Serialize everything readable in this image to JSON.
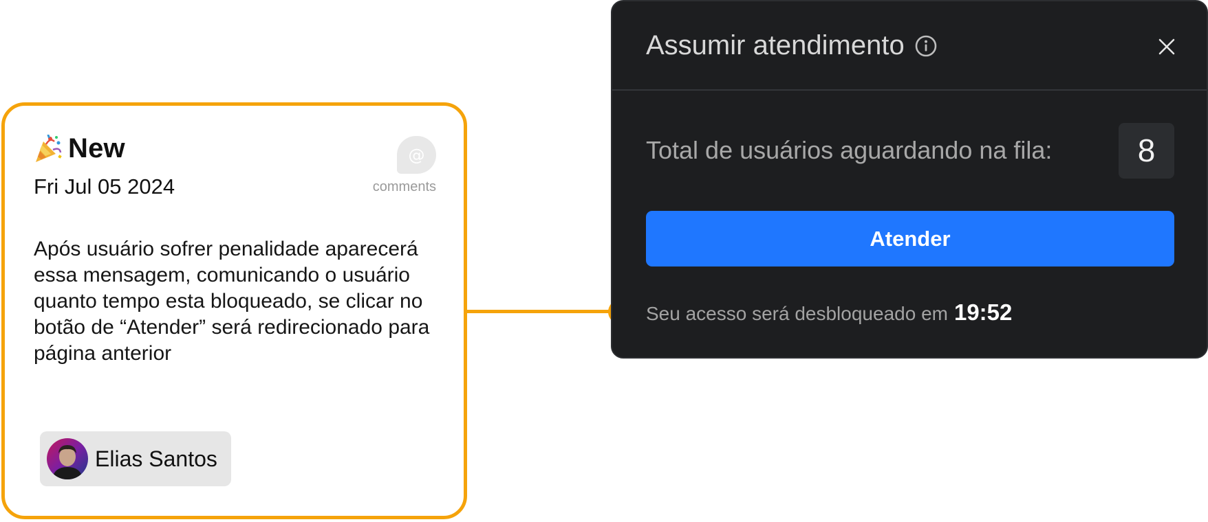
{
  "note": {
    "icon": "party-popper-icon",
    "title": "New",
    "date": "Fri Jul 05 2024",
    "comments_icon_glyph": "@",
    "comments_label": "comments",
    "body": "Após usuário sofrer penalidade aparecerá essa mensagem, comunicando o usuário quanto tempo esta bloqueado, se clicar no botão de “Atender” será redirecionado para página anterior",
    "author": {
      "name": "Elias Santos",
      "avatar_icon": "user-avatar-icon"
    },
    "accent_color": "#f5a30b"
  },
  "dialog": {
    "title": "Assumir atendimento",
    "title_icon": "info-icon",
    "close_icon": "close-icon",
    "queue_label": "Total de usuários aguardando na fila:",
    "queue_count": "8",
    "primary_button_label": "Atender",
    "unlock_prefix": "Seu acesso será desbloqueado em",
    "unlock_time": "19:52",
    "colors": {
      "background": "#1d1e20",
      "primary": "#1f77ff",
      "count_box": "#2b2d30"
    }
  }
}
